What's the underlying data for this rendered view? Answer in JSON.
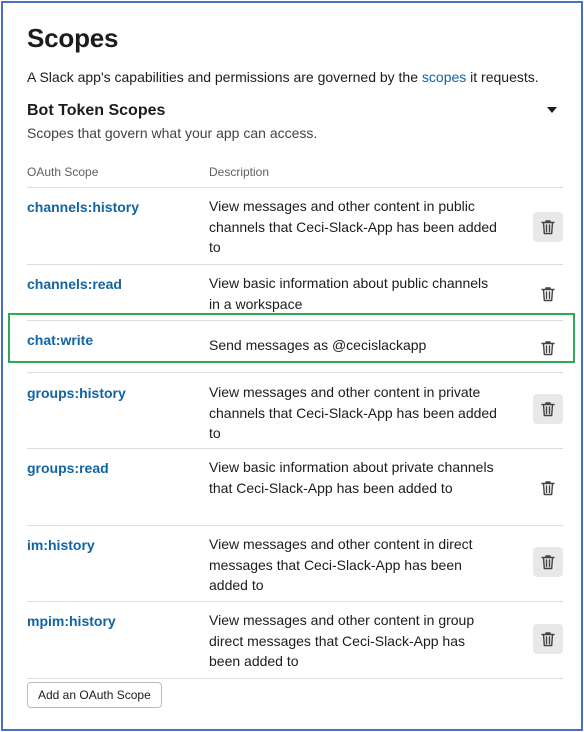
{
  "page": {
    "title": "Scopes",
    "intro_before": "A Slack app's capabilities and permissions are governed by the ",
    "intro_link": "scopes",
    "intro_after": " it requests."
  },
  "section": {
    "title": "Bot Token Scopes",
    "subtitle": "Scopes that govern what your app can access.",
    "collapse_icon": "caret-down-icon"
  },
  "table": {
    "headers": [
      "OAuth Scope",
      "Description"
    ],
    "rows": [
      {
        "scope": "channels:history",
        "description": "View messages and other content in public channels that Ceci-Slack-App has been added to",
        "icon": "trash-icon"
      },
      {
        "scope": "channels:read",
        "description": "View basic information about public channels in a workspace",
        "icon": "trash-icon"
      },
      {
        "scope": "chat:write",
        "description": "Send messages as @cecislackapp",
        "icon": "trash-icon"
      },
      {
        "scope": "groups:history",
        "description": "View messages and other content in private channels that Ceci-Slack-App has been added to",
        "icon": "trash-icon"
      },
      {
        "scope": "groups:read",
        "description": "View basic information about private channels that Ceci-Slack-App has been added to",
        "icon": "trash-icon"
      },
      {
        "scope": "im:history",
        "description": "View messages and other content in direct messages that Ceci-Slack-App has been added to",
        "icon": "trash-icon"
      },
      {
        "scope": "mpim:history",
        "description": "View messages and other content in group direct messages that Ceci-Slack-App has been added to",
        "icon": "trash-icon"
      }
    ]
  },
  "actions": {
    "add_scope_label": "Add an OAuth Scope"
  },
  "colors": {
    "link": "#1264a3",
    "frame_border": "#4472c4",
    "highlight_border": "#2eaa57"
  }
}
